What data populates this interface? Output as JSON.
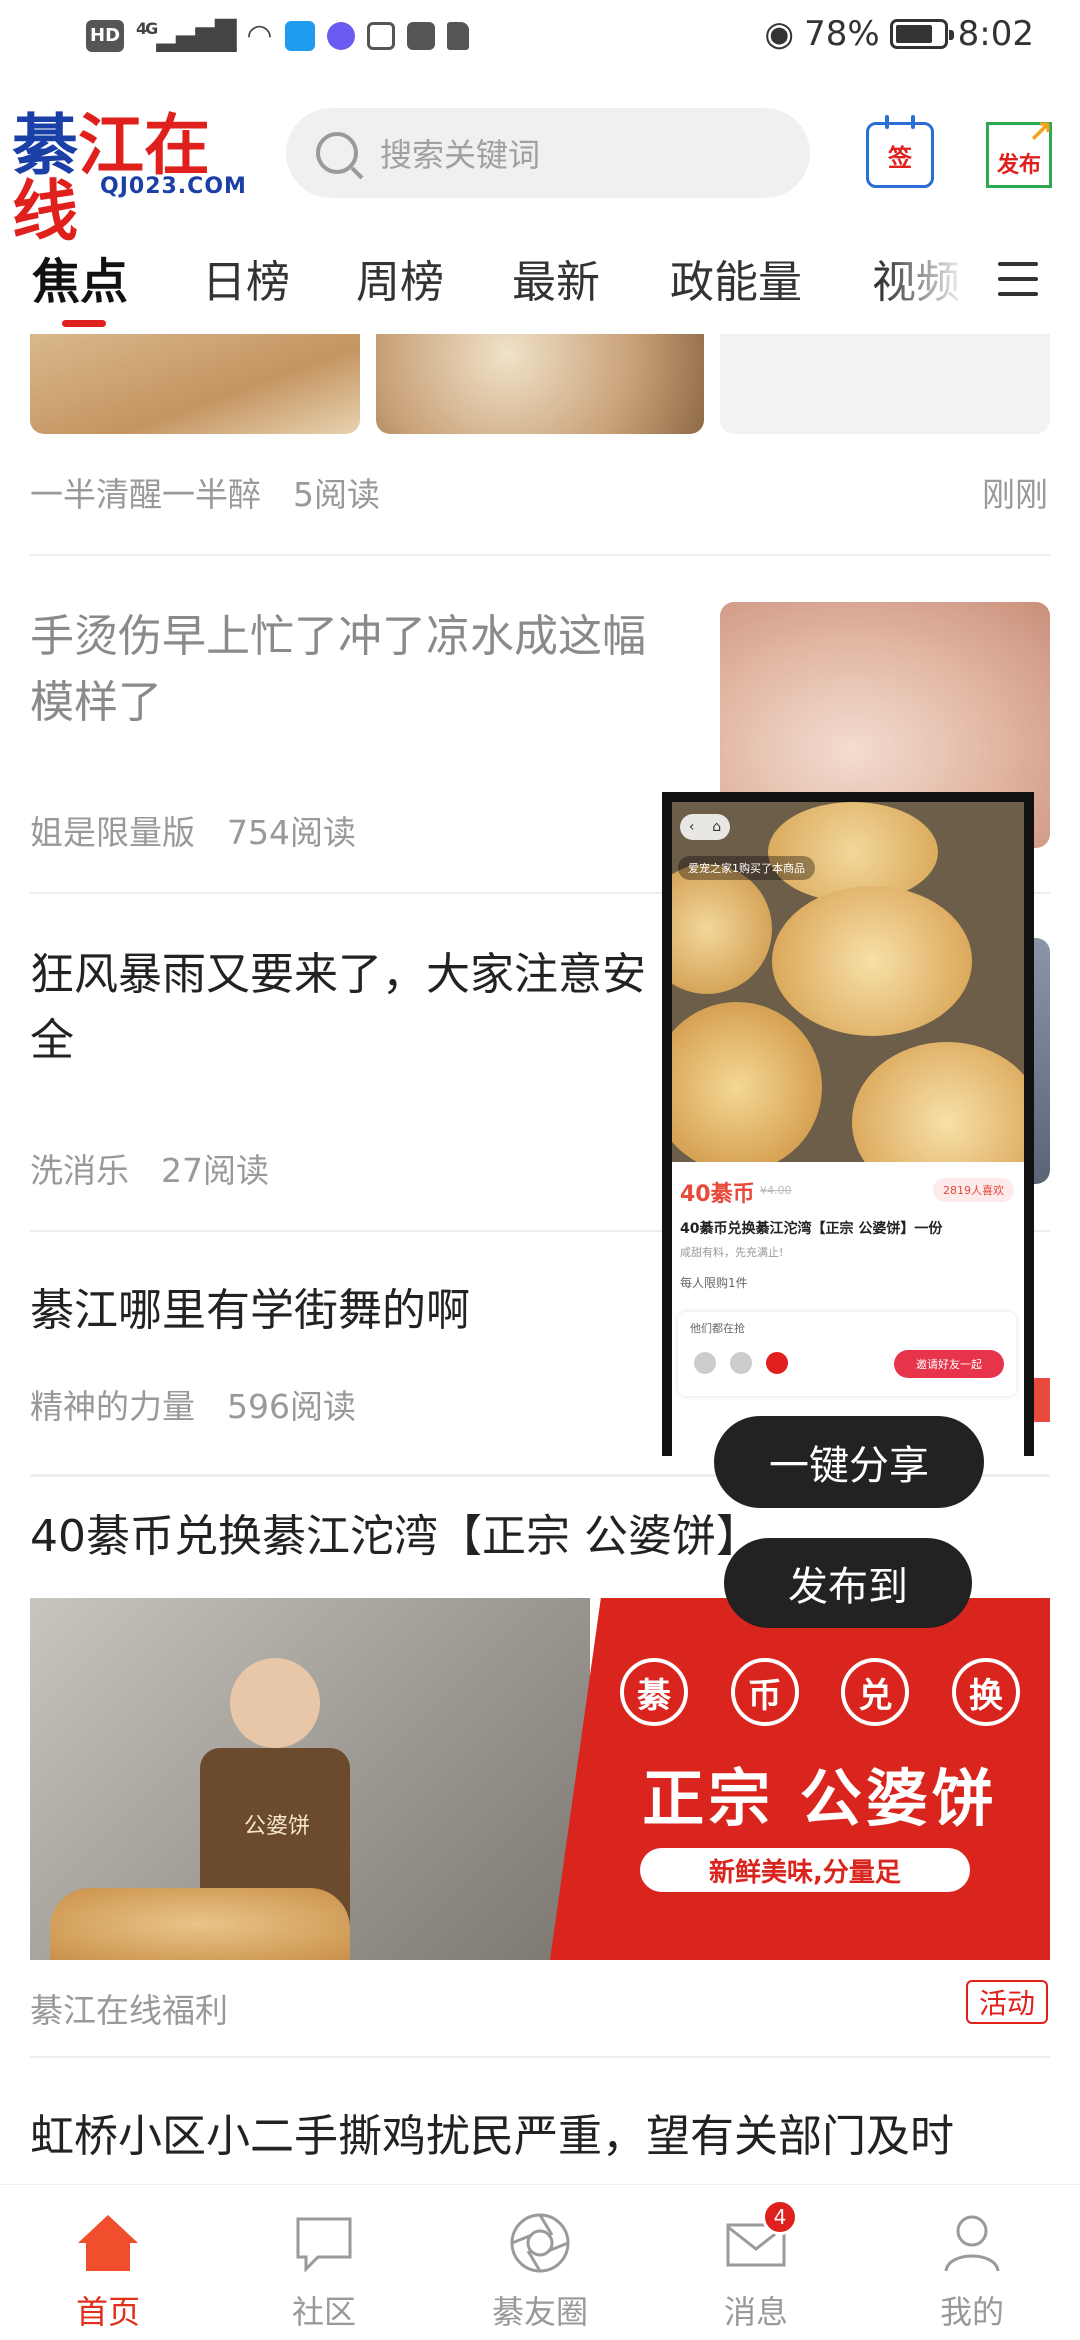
{
  "status_bar": {
    "left_chips": [
      "HD",
      "4G"
    ],
    "battery": "78%",
    "battery_level": 0.78,
    "time": "8:02"
  },
  "header": {
    "logo_char": "綦",
    "logo_text": "江在线",
    "logo_domain": "QJ023.COM",
    "search_placeholder": "搜索关键词",
    "sign_label": "签",
    "publish_label": "发布"
  },
  "tabs": [
    "焦点",
    "日榜",
    "周榜",
    "最新",
    "政能量",
    "视频"
  ],
  "feed": {
    "item0": {
      "author": "一半清醒一半醉",
      "reads": "5阅读",
      "time": "刚刚"
    },
    "item1": {
      "title": "手烫伤早上忙了冲了凉水成这幅模样了",
      "author": "姐是限量版",
      "reads": "754阅读"
    },
    "item2": {
      "title": "狂风暴雨又要来了，大家注意安全",
      "author": "洗消乐",
      "reads": "27阅读"
    },
    "item3": {
      "title": "綦江哪里有学街舞的啊",
      "author": "精神的力量",
      "reads": "596阅读"
    },
    "item4": {
      "title": "40綦币兑换綦江沱湾【正宗 公婆饼】",
      "banner_seal": [
        "綦",
        "币",
        "兑",
        "换"
      ],
      "banner_main": "正宗 公婆饼",
      "banner_sub": "新鲜美味,分量足",
      "apron_text": "公婆饼",
      "author": "綦江在线福利",
      "tag": "活动"
    },
    "item5": {
      "title": "虹桥小区小二手撕鸡扰民严重，望有关部门及时"
    }
  },
  "share_preview": {
    "tip": "爱宠之家1购买了本商品",
    "price": "40綦币",
    "old_price": "¥4.00",
    "likes": "2819人喜欢",
    "title": "40綦币兑换綦江沱湾【正宗 公婆饼】一份",
    "subtitle": "咸甜有料，先充满止!",
    "limit": "每人限购1件",
    "group_label": "他们都在抢",
    "invite": "邀请好友一起"
  },
  "share_button": "一键分享",
  "publish_to_button": "发布到",
  "bottom_nav": [
    {
      "label": "首页",
      "icon": "home-icon",
      "active": true
    },
    {
      "label": "社区",
      "icon": "chat-bubble-icon",
      "active": false
    },
    {
      "label": "綦友圈",
      "icon": "aperture-icon",
      "active": false
    },
    {
      "label": "消息",
      "icon": "mail-icon",
      "active": false,
      "badge": "4"
    },
    {
      "label": "我的",
      "icon": "profile-icon",
      "active": false
    }
  ],
  "colors": {
    "accent_red": "#e0201c",
    "logo_blue": "#1a3fa6",
    "banner_red": "#d9251d"
  }
}
